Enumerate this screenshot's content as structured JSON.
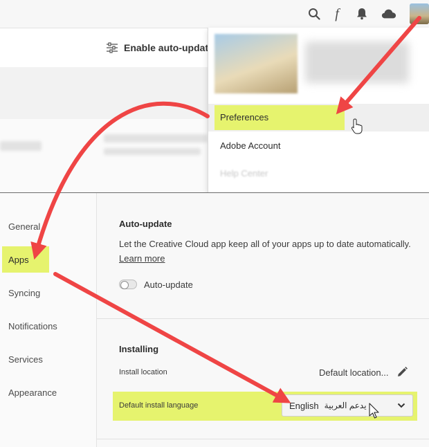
{
  "topbar": {
    "icons": [
      "search-icon",
      "fonts-icon",
      "bell-icon",
      "cloud-icon"
    ],
    "fonts_glyph": "f",
    "enable_auto_update": "Enable auto-update"
  },
  "menu": {
    "preferences": "Preferences",
    "adobe_account": "Adobe Account",
    "help_center": "Help Center"
  },
  "preferences": {
    "sidebar": [
      "General",
      "Apps",
      "Syncing",
      "Notifications",
      "Services",
      "Appearance"
    ],
    "selected": "Apps",
    "auto_update": {
      "title": "Auto-update",
      "description": "Let the Creative Cloud app keep all of your apps up to date automatically.",
      "learn_more": "Learn more",
      "toggle_label": "Auto-update",
      "toggle_on": false
    },
    "installing": {
      "title": "Installing",
      "install_location_label": "Install location",
      "install_location_value": "Default location...",
      "language_label": "Default install language",
      "language_value": "English",
      "language_value_arabic": "يدعم العربية"
    }
  },
  "colors": {
    "highlight": "#e6f36e",
    "arrow": "#ef4545"
  }
}
